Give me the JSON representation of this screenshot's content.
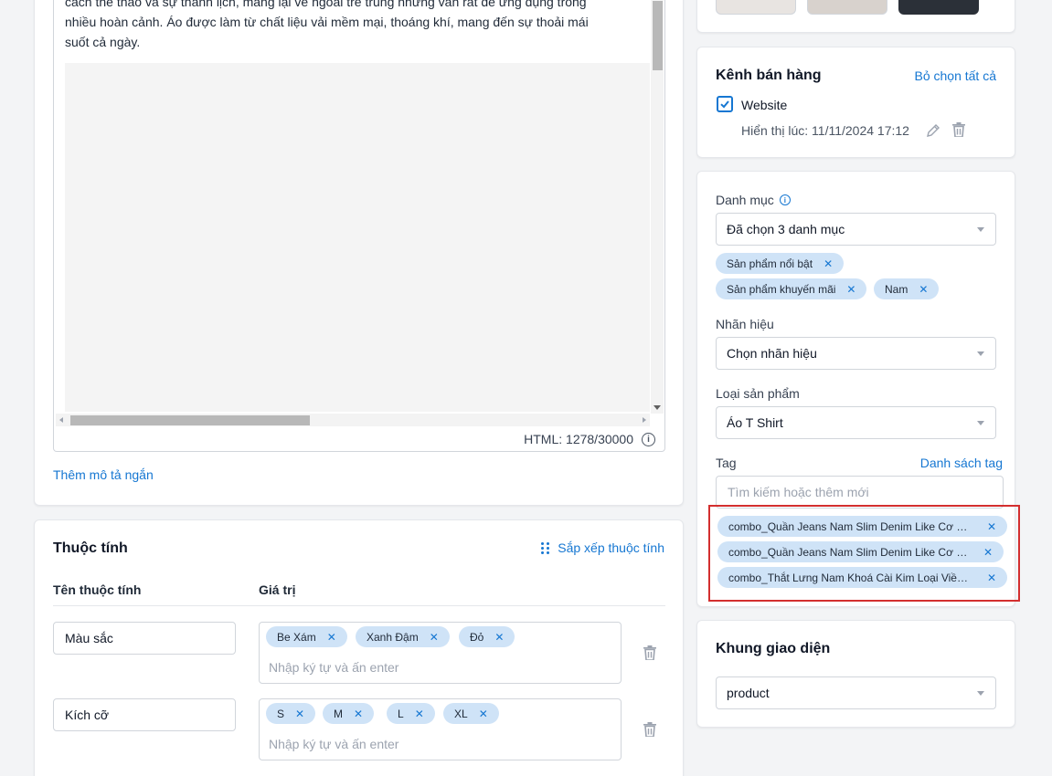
{
  "editor": {
    "text_line1": "cách thể thao và sự thanh lịch, mang lại vẻ ngoài trẻ trung nhưng vẫn rất dễ ứng dụng trong",
    "text_line2": "nhiều hoàn cảnh. Áo được làm từ chất liệu vải mềm mại, thoáng khí, mang đến sự thoải mái",
    "text_line3": "suốt cả ngày.",
    "html_counter": "HTML: 1278/30000",
    "add_short_desc": "Thêm mô tả ngắn"
  },
  "attributes": {
    "title": "Thuộc tính",
    "sort_link": "Sắp xếp thuộc tính",
    "col_name": "Tên thuộc tính",
    "col_value": "Giá trị",
    "rows": [
      {
        "name": "Màu sắc",
        "values": [
          "Be Xám",
          "Xanh Đậm",
          "Đỏ"
        ],
        "placeholder": "Nhập ký tự và ấn enter"
      },
      {
        "name": "Kích cỡ",
        "values": [
          "S",
          "M",
          "L",
          "XL"
        ],
        "placeholder": "Nhập ký tự và ấn enter"
      }
    ]
  },
  "sales_channel": {
    "title": "Kênh bán hàng",
    "deselect_all": "Bỏ chọn tất cả",
    "website_label": "Website",
    "display_time": "Hiển thị lúc: 11/11/2024 17:12"
  },
  "category": {
    "label": "Danh mục",
    "selected": "Đã chọn 3 danh mục",
    "tags": [
      "Sản phẩm nổi bật",
      "Sản phẩm khuyến mãi",
      "Nam"
    ]
  },
  "brand": {
    "label": "Nhãn hiệu",
    "selected": "Chọn nhãn hiệu"
  },
  "product_type": {
    "label": "Loại sản phẩm",
    "selected": "Áo T Shirt"
  },
  "tag": {
    "label": "Tag",
    "list_link": "Danh sách tag",
    "search_placeholder": "Tìm kiếm hoặc thêm mới",
    "items": [
      "combo_Quần Jeans Nam Slim Denim Like Cơ Bản",
      "combo_Quần Jeans Nam Slim Denim Like Cơ Bản",
      "combo_Thắt Lưng Nam Khoá Cài Kim Loại Viền Mạ"
    ]
  },
  "template": {
    "title": "Khung giao diện",
    "selected": "product"
  },
  "colors": {
    "accent": "#1677d2",
    "tag_bg": "#cfe3f7",
    "highlight": "#d32f2f"
  }
}
